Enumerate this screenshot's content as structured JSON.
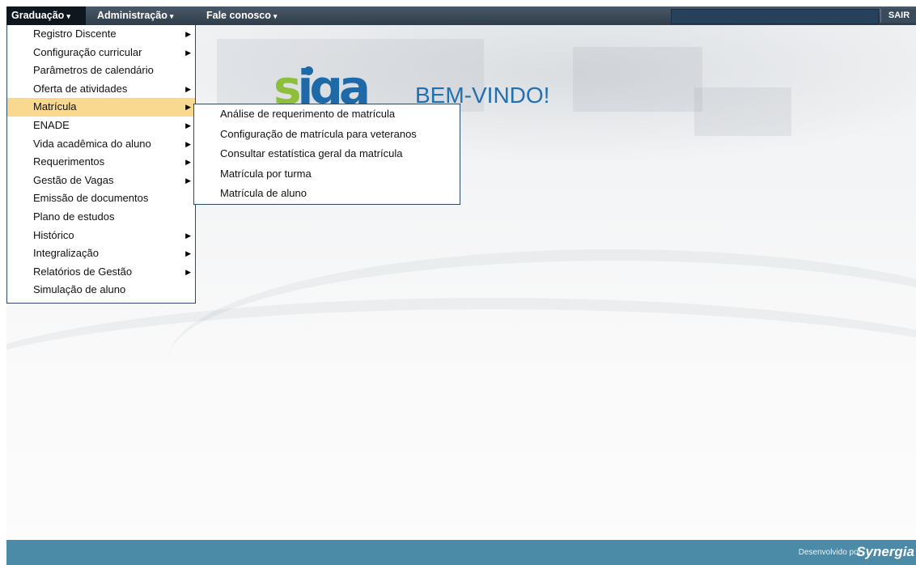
{
  "navbar": {
    "items": [
      {
        "label": "Graduação",
        "caret": "▾"
      },
      {
        "label": "Administração",
        "caret": "▾"
      },
      {
        "label": "Fale conosco",
        "caret": "▾"
      }
    ],
    "logout_label": "SAIR"
  },
  "logo": {
    "first": "s",
    "rest": "iga"
  },
  "welcome": "BEM-VINDO!",
  "menu": {
    "items": [
      {
        "label": "Registro Discente",
        "arrow": "▶"
      },
      {
        "label": "Configuração curricular",
        "arrow": "▶"
      },
      {
        "label": "Parâmetros de calendário",
        "arrow": ""
      },
      {
        "label": "Oferta de atividades",
        "arrow": "▶"
      },
      {
        "label": "Matrícula",
        "arrow": "▶"
      },
      {
        "label": "ENADE",
        "arrow": "▶"
      },
      {
        "label": "Vida acadêmica do aluno",
        "arrow": "▶"
      },
      {
        "label": "Requerimentos",
        "arrow": "▶"
      },
      {
        "label": "Gestão de Vagas",
        "arrow": "▶"
      },
      {
        "label": "Emissão de documentos",
        "arrow": ""
      },
      {
        "label": "Plano de estudos",
        "arrow": ""
      },
      {
        "label": "Histórico",
        "arrow": "▶"
      },
      {
        "label": "Integralização",
        "arrow": "▶"
      },
      {
        "label": "Relatórios de Gestão",
        "arrow": "▶"
      },
      {
        "label": "Simulação de aluno",
        "arrow": ""
      }
    ],
    "highlighted_index": 4,
    "highlight_color": "#f9d890"
  },
  "submenu": {
    "items": [
      {
        "label": "Análise de requerimento de matrícula"
      },
      {
        "label": "Configuração de matrícula para veteranos"
      },
      {
        "label": "Consultar estatística geral da matrícula"
      },
      {
        "label": "Matrícula por turma"
      },
      {
        "label": "Matrícula de aluno"
      }
    ]
  },
  "footer": {
    "developed_by": "Desenvolvido por",
    "brand": "Synergia"
  },
  "colors": {
    "navbar": "#2f3d4a",
    "footer": "#4b8ba8",
    "logo_green": "#8dbf3c",
    "logo_blue": "#1e6aa8"
  }
}
